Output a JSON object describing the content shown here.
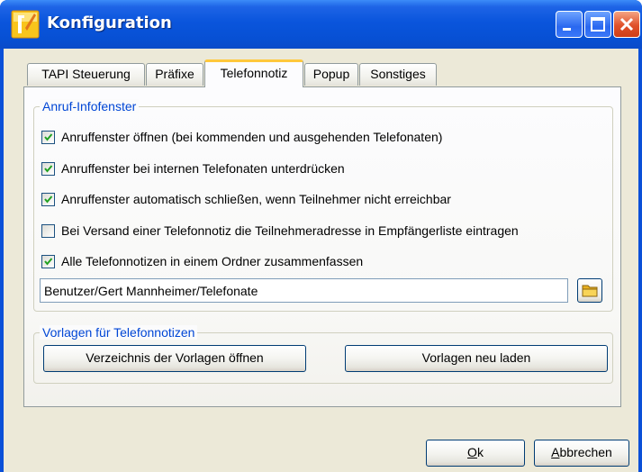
{
  "window": {
    "title": "Konfiguration"
  },
  "tabs": [
    {
      "label": "TAPI Steuerung",
      "active": false
    },
    {
      "label": "Präfixe",
      "active": false
    },
    {
      "label": "Telefonnotiz",
      "active": true
    },
    {
      "label": "Popup",
      "active": false
    },
    {
      "label": "Sonstiges",
      "active": false
    }
  ],
  "anruf_infofenster": {
    "title": "Anruf-Infofenster",
    "options": [
      {
        "label": "Anruffenster öffnen (bei kommenden und ausgehenden Telefonaten)",
        "checked": true
      },
      {
        "label": "Anruffenster bei internen Telefonaten unterdrücken",
        "checked": true
      },
      {
        "label": "Anruffenster automatisch schließen, wenn Teilnehmer nicht erreichbar",
        "checked": true
      },
      {
        "label": "Bei Versand einer Telefonnotiz die Teilnehmeradresse in Empfängerliste eintragen",
        "checked": false
      },
      {
        "label": "Alle Telefonnotizen in einem Ordner zusammenfassen",
        "checked": true
      }
    ],
    "folder_path": "Benutzer/Gert Mannheimer/Telefonate",
    "folder_button_icon": "folder-icon"
  },
  "vorlagen": {
    "title": "Vorlagen für Telefonnotizen",
    "open_button_label": "Verzeichnis der Vorlagen öffnen",
    "reload_button_label": "Vorlagen neu laden"
  },
  "footer": {
    "ok_mnemonic": "O",
    "ok_rest": "k",
    "cancel_mnemonic": "A",
    "cancel_rest": "bbrechen"
  },
  "colors": {
    "titlebar": "#0a55dc",
    "group_title": "#0046d5",
    "dialog_bg": "#ece9d8",
    "close_button": "#e0512a"
  }
}
